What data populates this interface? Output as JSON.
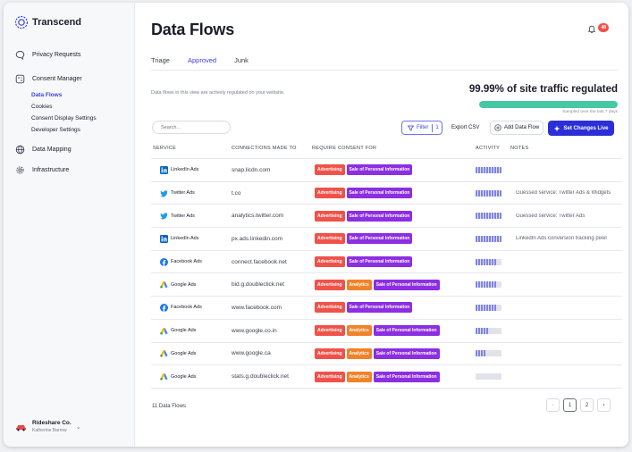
{
  "app": {
    "brand": "Transcend",
    "page_title": "Data Flows"
  },
  "sidebar": {
    "items": [
      {
        "label": "Privacy Requests",
        "icon": "chat-bubble-icon"
      },
      {
        "label": "Consent Manager",
        "icon": "cookie-grid-icon",
        "subitems": [
          {
            "label": "Data Flows",
            "active": true
          },
          {
            "label": "Cookies"
          },
          {
            "label": "Consent Display Settings"
          },
          {
            "label": "Developer Settings"
          }
        ]
      },
      {
        "label": "Data Mapping",
        "icon": "globe-icon"
      },
      {
        "label": "Infrastructure",
        "icon": "gear-icon"
      }
    ],
    "org": {
      "name": "Rideshare Co.",
      "user": "Katherine Barrow"
    }
  },
  "notifications": {
    "count": "48"
  },
  "tabs": [
    {
      "label": "Triage",
      "active": false
    },
    {
      "label": "Approved",
      "active": true
    },
    {
      "label": "Junk",
      "active": false
    }
  ],
  "summary": {
    "description": "Data flows in this view are actively regulated on your website.",
    "regulated_text": "99.99% of site traffic regulated",
    "regulated_fraction": 0.9999,
    "sampled_text": "Sampled over the last 7 days"
  },
  "toolbar": {
    "search_placeholder": "Search...",
    "filter_label": "Filter",
    "filter_count": "1",
    "export_label": "Export CSV",
    "add_label": "Add Data Flow",
    "live_label": "Set Changes Live"
  },
  "table": {
    "headers": [
      "SERVICE",
      "CONNECTIONS MADE TO",
      "REQUIRE CONSENT FOR",
      "ACTIVITY",
      "NOTES"
    ],
    "rows": [
      {
        "service": "LinkedIn Ads",
        "icon": "linkedin-icon",
        "connection": "snap.licdn.com",
        "consents": [
          "Advertising",
          "Sale of Personal Information"
        ],
        "activity": 0.8,
        "notes": ""
      },
      {
        "service": "Twitter Ads",
        "icon": "twitter-icon",
        "connection": "t.co",
        "consents": [
          "Advertising",
          "Sale of Personal Information"
        ],
        "activity": 0.8,
        "notes": "Guessed service: Twitter Ads & Widgets"
      },
      {
        "service": "Twitter Ads",
        "icon": "twitter-icon",
        "connection": "analytics.twitter.com",
        "consents": [
          "Advertising",
          "Sale of Personal Information"
        ],
        "activity": 0.8,
        "notes": "Guessed service: Twitter Ads"
      },
      {
        "service": "LinkedIn Ads",
        "icon": "linkedin-icon",
        "connection": "px.ads.linkedin.com",
        "consents": [
          "Advertising",
          "Sale of Personal Information"
        ],
        "activity": 0.8,
        "notes": "LinkedIn Ads conversion tracking pixel"
      },
      {
        "service": "Facebook Ads",
        "icon": "facebook-icon",
        "connection": "connect.facebook.net",
        "consents": [
          "Advertising",
          "Sale of Personal Information"
        ],
        "activity": 0.7,
        "notes": ""
      },
      {
        "service": "Google Ads",
        "icon": "google-ads-icon",
        "connection": "bid.g.doubleclick.net",
        "consents": [
          "Advertising",
          "Analytics",
          "Sale of Personal Information"
        ],
        "activity": 0.65,
        "notes": ""
      },
      {
        "service": "Facebook Ads",
        "icon": "facebook-icon",
        "connection": "www.facebook.com",
        "consents": [
          "Advertising",
          "Sale of Personal Information"
        ],
        "activity": 0.65,
        "notes": ""
      },
      {
        "service": "Google Ads",
        "icon": "google-ads-icon",
        "connection": "www.google.co.in",
        "consents": [
          "Advertising",
          "Analytics",
          "Sale of Personal Information"
        ],
        "activity": 0.4,
        "notes": ""
      },
      {
        "service": "Google Ads",
        "icon": "google-ads-icon",
        "connection": "www.google.ca",
        "consents": [
          "Advertising",
          "Analytics",
          "Sale of Personal Information"
        ],
        "activity": 0.3,
        "notes": ""
      },
      {
        "service": "Google Ads",
        "icon": "google-ads-icon",
        "connection": "stats.g.doubleclick.net",
        "consents": [
          "Advertising",
          "Analytics",
          "Sale of Personal Information"
        ],
        "activity": 0.0,
        "notes": ""
      }
    ]
  },
  "footer": {
    "count_text": "11 Data Flows",
    "pages": [
      "1",
      "2"
    ],
    "current_page": "1"
  },
  "colors": {
    "accent": "#3a3fe0",
    "advertising": "#f0524a",
    "analytics": "#f0832a",
    "sale": "#8c2ee2",
    "progress": "#46c8a3"
  }
}
